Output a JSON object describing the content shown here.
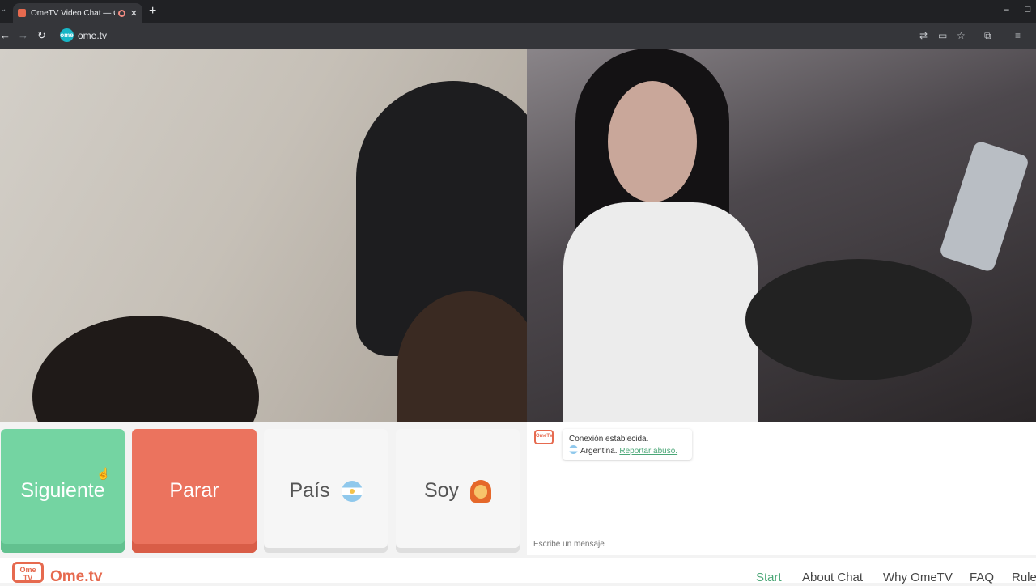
{
  "browser": {
    "tab_title": "OmeTV Video Chat — Ome",
    "tab_close": "✕",
    "new_tab": "+",
    "url": "ome.tv",
    "site_icon": "ome",
    "window_minimize": "–",
    "window_maximize": "□"
  },
  "buttons": {
    "next": "Siguiente",
    "stop": "Parar",
    "country": "País",
    "gender": "Soy"
  },
  "chat": {
    "logo": "OmeTV",
    "status": "Conexión establecida.",
    "country": "Argentina.",
    "report": "Reportar abuso.",
    "input_placeholder": "Escribe un mensaje"
  },
  "footer": {
    "logo_line1": "Ome",
    "logo_line2": "TV",
    "brand": "Ome.tv",
    "nav": [
      "Start",
      "About Chat",
      "Why OmeTV",
      "FAQ",
      "Rules"
    ]
  },
  "colors": {
    "next": "#74d4a2",
    "stop": "#eb735e",
    "brand": "#e66a4f",
    "active_link": "#4ba777"
  },
  "icons": [
    "tab-search-icon",
    "back-arrow-icon",
    "forward-arrow-icon",
    "reload-icon",
    "translate-icon",
    "cast-icon",
    "bookmark-star-icon",
    "extensions-icon",
    "media-icon",
    "argentina-flag-icon",
    "girl-emoji-icon",
    "cursor-icon"
  ]
}
